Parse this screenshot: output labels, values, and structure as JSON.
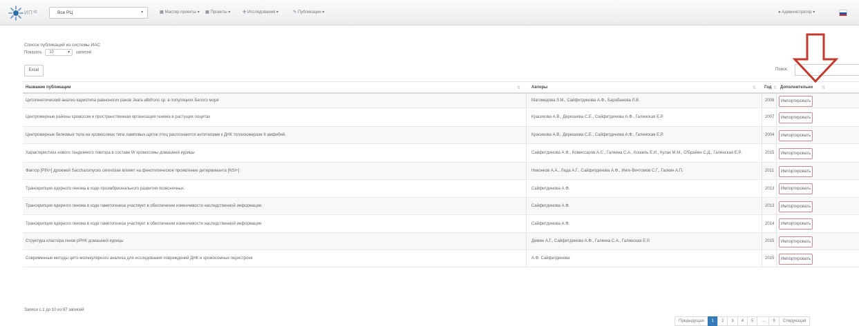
{
  "navbar": {
    "brand": "ИП",
    "collapse_glyph": "«",
    "rc_select": {
      "value": "Все РЦ"
    },
    "menu": [
      {
        "label": "Мастер проекты",
        "icon": "grid-icon"
      },
      {
        "label": "Проекты",
        "icon": "grid-icon"
      },
      {
        "label": "Исследования",
        "icon": "network-icon"
      },
      {
        "label": "Публикации",
        "icon": "wrench-icon"
      }
    ],
    "user_label": "Администратор",
    "icons": {
      "user": "user-icon",
      "flag": "russian-flag-icon"
    }
  },
  "content": {
    "caption": "Список публикаций из системы ИАС",
    "show_label": "Показать",
    "show_value": "10",
    "entries_label": "записей",
    "excel_label": "Excel",
    "search_label": "Поиск:"
  },
  "table": {
    "columns": [
      "Название публикации",
      "Авторы",
      "Год",
      "Дополнительно"
    ],
    "rows": [
      {
        "title": "Цитогенетический анализ кариотипа равноногих раков Jeara albifrons sp. в популяциях Белого моря",
        "authors": "Магомедова З.М., Сайфитдинова А.Ф., Барабанова Л.В.",
        "year": "2008",
        "action": "Импортировать"
      },
      {
        "title": "Центромерные районы хромосом и пространственная организация генома в растущих ооцитах",
        "authors": "Красикова А.В., Дерюшева С.Е., Сайфитдинова А.Ф., Галинская Е.Р.",
        "year": "2007",
        "action": "Импортировать"
      },
      {
        "title": "Центромерные белковые тела на хромосомах типа ламповых щеток птиц распознаются антителами к ДНК топоизомеразе II амфибий.",
        "authors": "Красикова А.В., Дерюшева С.Е., Сайфитдинова А.Ф., Галинская Е.Р.",
        "year": "2004",
        "action": "Импортировать"
      },
      {
        "title": "Характеристика нового тандемного повтора в составе W хромосомы домашней курицы",
        "authors": "Сайфитдинова А.Ф., Комиссаров А.С., Галкина С.А., Кошель Е.И., Кулак М.М., О'Брайен С.Д., Галинская Е.Р.",
        "year": "2015",
        "action": "Импортировать"
      },
      {
        "title": "Фактор [PIN+] дрожжей Saccharomyces cerevisiae влияет на фенотипическое проявление детерминанта [NSI+]",
        "authors": "Никонков А.А., Лада А.Г., Сайфитдинова А.Ф., Инге-Вечтомов С.Г., Галкин А.П.",
        "year": "2011",
        "action": "Импортировать"
      },
      {
        "title": "Транскрипция ядерного генома в ходе проэмбрионального развития позвоночных.",
        "authors": "Сайфитдинова А.Ф.",
        "year": "2013",
        "action": "Импортировать"
      },
      {
        "title": "Транскрипция ядерного генома в ходе гаметогенеза участвует в обеспечении изменчивости наследственной информации.",
        "authors": "Сайфитдинова А.Ф.",
        "year": "2013",
        "action": "Импортировать"
      },
      {
        "title": "Транскрипция ядерного генома в ходе гаметогенеза участвует в обеспечении изменчивости наследственной информации",
        "authors": "Сайфитдинова А.Ф.",
        "year": "2014",
        "action": "Импортировать"
      },
      {
        "title": "Структура кластера генов рРНК домашней курицы",
        "authors": "Демин А.Г., Сайфитдинова А.Ф., Галкина С.А., Галинская Е.Р.",
        "year": "2015",
        "action": "Импортировать"
      },
      {
        "title": "Современные методы цито-молекулярного анализа для исследования повреждений ДНК и хромосомных перестроек",
        "authors": "А.Ф. Сайфитдинова",
        "year": "2015",
        "action": "Импортировать"
      }
    ]
  },
  "footer": {
    "info": "Записи с 1 до 10 из 87 записей",
    "pager": [
      "Предыдущая",
      "1",
      "2",
      "3",
      "4",
      "5",
      "…",
      "9",
      "Следующая"
    ],
    "active_page": "1"
  },
  "colors": {
    "arrow": "#c0392b",
    "primary": "#337ab7",
    "import_border": "#c58b8b"
  }
}
